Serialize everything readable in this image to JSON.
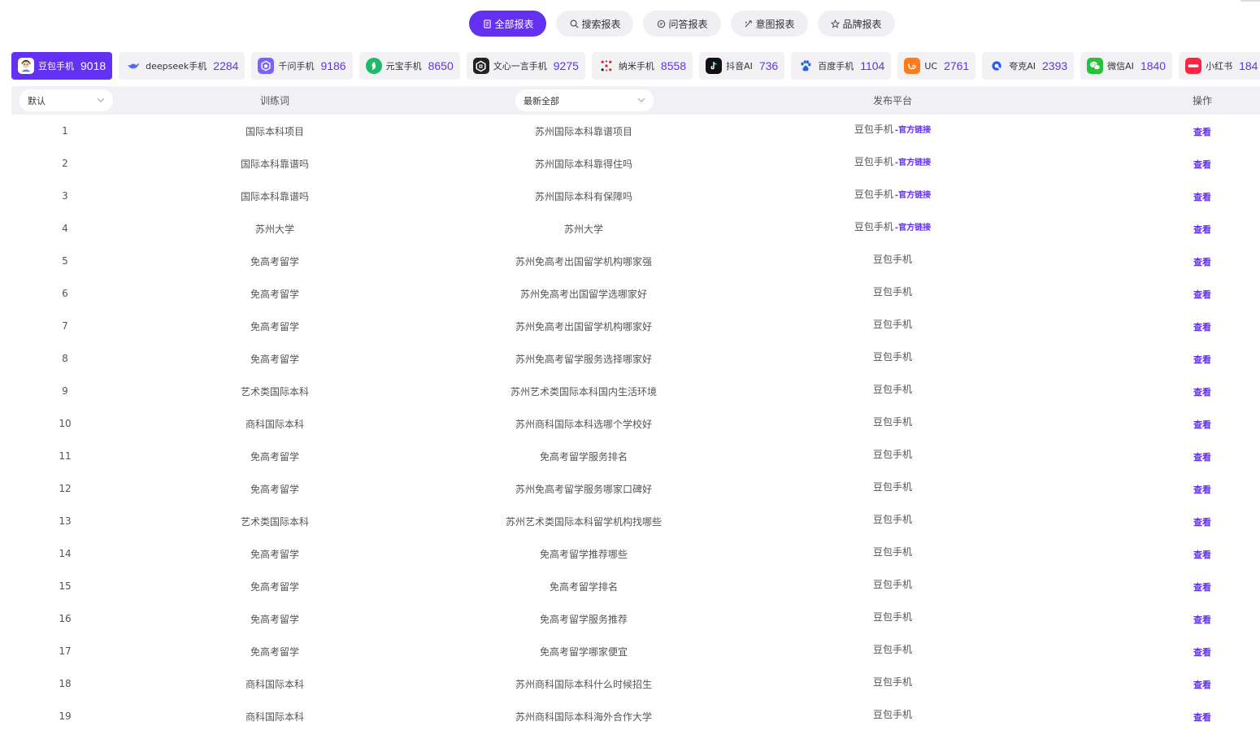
{
  "tabs": [
    {
      "label": "全部报表",
      "icon": "document-icon",
      "active": true
    },
    {
      "label": "搜索报表",
      "icon": "search-icon",
      "active": false
    },
    {
      "label": "问答报表",
      "icon": "chat-icon",
      "active": false
    },
    {
      "label": "意图报表",
      "icon": "intent-icon",
      "active": false
    },
    {
      "label": "品牌报表",
      "icon": "star-icon",
      "active": false
    }
  ],
  "platforms": [
    {
      "name": "豆包手机",
      "count": "9018",
      "icon": "doubao-logo",
      "color": "#ffffff",
      "active": true
    },
    {
      "name": "deepseek手机",
      "count": "2284",
      "icon": "deepseek-logo",
      "color": "#4d6bfe",
      "active": false
    },
    {
      "name": "千问手机",
      "count": "9186",
      "icon": "qianwen-logo",
      "color": "#7b61ff",
      "active": false
    },
    {
      "name": "元宝手机",
      "count": "8650",
      "icon": "yuanbao-logo",
      "color": "#1fb96a",
      "active": false
    },
    {
      "name": "文心一言手机",
      "count": "9275",
      "icon": "wenxin-logo",
      "color": "#222222",
      "active": false
    },
    {
      "name": "纳米手机",
      "count": "8558",
      "icon": "nami-logo",
      "color": "#e0202e",
      "active": false
    },
    {
      "name": "抖音AI",
      "count": "736",
      "icon": "douyin-logo",
      "color": "#111111",
      "active": false
    },
    {
      "name": "百度手机",
      "count": "1104",
      "icon": "baidu-logo",
      "color": "#2b5fe3",
      "active": false
    },
    {
      "name": "UC",
      "count": "2761",
      "icon": "uc-logo",
      "color": "#ff7a1a",
      "active": false
    },
    {
      "name": "夸克AI",
      "count": "2393",
      "icon": "quark-logo",
      "color": "#2b59ff",
      "active": false
    },
    {
      "name": "微信AI",
      "count": "1840",
      "icon": "wechat-logo",
      "color": "#25c23a",
      "active": false
    },
    {
      "name": "小红书",
      "count": "184",
      "icon": "xiaohongshu-logo",
      "color": "#ff2442",
      "active": false
    }
  ],
  "table": {
    "sort_select": "默认",
    "col_keyword": "训练词",
    "filter_select": "最新全部",
    "col_platform": "发布平台",
    "col_action": "操作",
    "official_label": "-官方链接",
    "view_label": "查看",
    "rows": [
      {
        "idx": "1",
        "keyword": "国际本科项目",
        "question": "苏州国际本科靠谱项目",
        "platform": "豆包手机",
        "official": true
      },
      {
        "idx": "2",
        "keyword": "国际本科靠谱吗",
        "question": "苏州国际本科靠得住吗",
        "platform": "豆包手机",
        "official": true
      },
      {
        "idx": "3",
        "keyword": "国际本科靠谱吗",
        "question": "苏州国际本科有保障吗",
        "platform": "豆包手机",
        "official": true
      },
      {
        "idx": "4",
        "keyword": "苏州大学",
        "question": "苏州大学",
        "platform": "豆包手机",
        "official": true
      },
      {
        "idx": "5",
        "keyword": "免高考留学",
        "question": "苏州免高考出国留学机构哪家强",
        "platform": "豆包手机",
        "official": false
      },
      {
        "idx": "6",
        "keyword": "免高考留学",
        "question": "苏州免高考出国留学选哪家好",
        "platform": "豆包手机",
        "official": false
      },
      {
        "idx": "7",
        "keyword": "免高考留学",
        "question": "苏州免高考出国留学机构哪家好",
        "platform": "豆包手机",
        "official": false
      },
      {
        "idx": "8",
        "keyword": "免高考留学",
        "question": "苏州免高考留学服务选择哪家好",
        "platform": "豆包手机",
        "official": false
      },
      {
        "idx": "9",
        "keyword": "艺术类国际本科",
        "question": "苏州艺术类国际本科国内生活环境",
        "platform": "豆包手机",
        "official": false
      },
      {
        "idx": "10",
        "keyword": "商科国际本科",
        "question": "苏州商科国际本科选哪个学校好",
        "platform": "豆包手机",
        "official": false
      },
      {
        "idx": "11",
        "keyword": "免高考留学",
        "question": "免高考留学服务排名",
        "platform": "豆包手机",
        "official": false
      },
      {
        "idx": "12",
        "keyword": "免高考留学",
        "question": "苏州免高考留学服务哪家口碑好",
        "platform": "豆包手机",
        "official": false
      },
      {
        "idx": "13",
        "keyword": "艺术类国际本科",
        "question": "苏州艺术类国际本科留学机构找哪些",
        "platform": "豆包手机",
        "official": false
      },
      {
        "idx": "14",
        "keyword": "免高考留学",
        "question": "免高考留学推荐哪些",
        "platform": "豆包手机",
        "official": false
      },
      {
        "idx": "15",
        "keyword": "免高考留学",
        "question": "免高考留学排名",
        "platform": "豆包手机",
        "official": false
      },
      {
        "idx": "16",
        "keyword": "免高考留学",
        "question": "免高考留学服务推荐",
        "platform": "豆包手机",
        "official": false
      },
      {
        "idx": "17",
        "keyword": "免高考留学",
        "question": "免高考留学哪家便宜",
        "platform": "豆包手机",
        "official": false
      },
      {
        "idx": "18",
        "keyword": "商科国际本科",
        "question": "苏州商科国际本科什么时候招生",
        "platform": "豆包手机",
        "official": false
      },
      {
        "idx": "19",
        "keyword": "商科国际本科",
        "question": "苏州商科国际本科海外合作大学",
        "platform": "豆包手机",
        "official": false
      }
    ]
  },
  "colors": {
    "accent": "#6431f2",
    "header_bg": "#f1f1f5",
    "chip_bg": "#f2f2f5"
  }
}
